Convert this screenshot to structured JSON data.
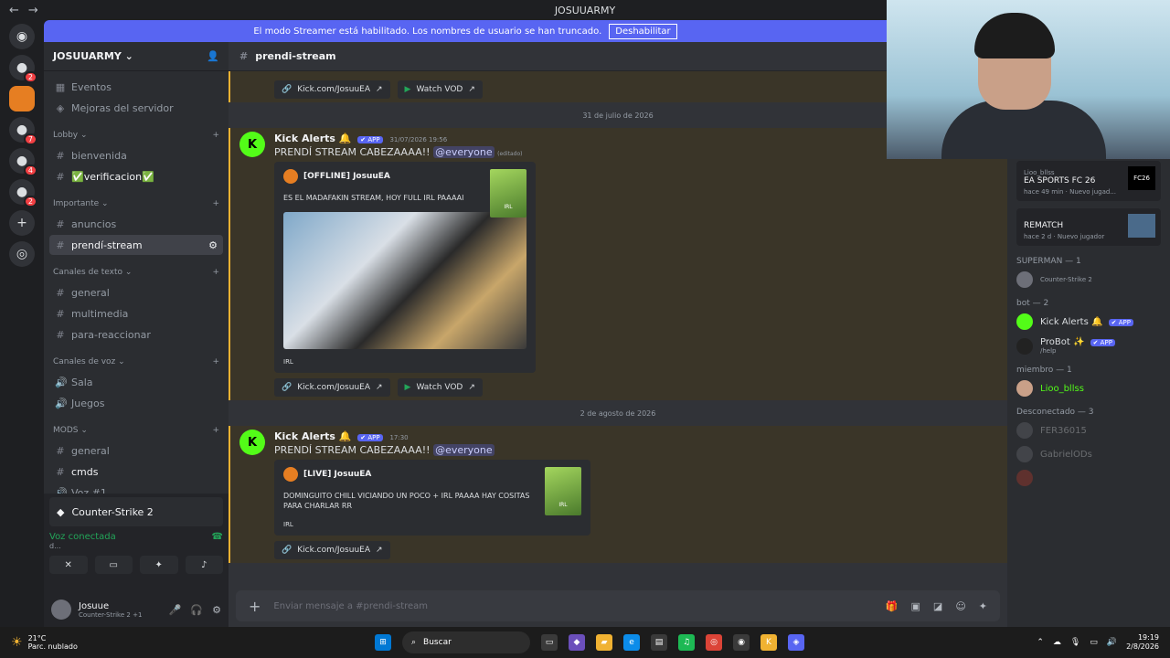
{
  "window": {
    "title": "JOSUUARMY",
    "back": "←",
    "forward": "→"
  },
  "banner": {
    "text": "El modo Streamer está habilitado. Los nombres de usuario se han truncado.",
    "button": "Deshabilitar"
  },
  "servers": [
    {
      "name": "discord-home",
      "glyph": "◉",
      "badge": ""
    },
    {
      "name": "server-1",
      "glyph": "●",
      "badge": "2"
    },
    {
      "name": "server-josuuarmy",
      "glyph": "●",
      "badge": ""
    },
    {
      "name": "server-3",
      "glyph": "●",
      "badge": "7"
    },
    {
      "name": "server-4",
      "glyph": "●",
      "badge": "4"
    },
    {
      "name": "server-5",
      "glyph": "●",
      "badge": "2"
    },
    {
      "name": "add-server",
      "glyph": "+",
      "badge": ""
    },
    {
      "name": "discover",
      "glyph": "◎",
      "badge": ""
    }
  ],
  "guild": {
    "name": "JOSUUARMY ⌄"
  },
  "channels": {
    "top": [
      {
        "icon": "▦",
        "label": "Eventos"
      },
      {
        "icon": "◈",
        "label": "Mejoras del servidor"
      }
    ],
    "cat_lobby": "Lobby ⌄",
    "lobby": [
      {
        "icon": "#",
        "label": "bienvenida"
      },
      {
        "icon": "#",
        "label": "✅verificacion✅"
      }
    ],
    "cat_importante": "Importante ⌄",
    "importante": [
      {
        "icon": "#",
        "label": "anuncios"
      },
      {
        "icon": "#",
        "label": "prendí-stream"
      }
    ],
    "cat_texto": "Canales de texto ⌄",
    "texto": [
      {
        "icon": "#",
        "label": "general"
      },
      {
        "icon": "#",
        "label": "multimedia"
      },
      {
        "icon": "#",
        "label": "para-reaccionar"
      }
    ],
    "cat_voz": "Canales de voz ⌄",
    "voz": [
      {
        "icon": "🔊",
        "label": "Sala"
      },
      {
        "icon": "🔊",
        "label": "Juegos"
      }
    ],
    "cat_mods": "MODS ⌄",
    "mods": [
      {
        "icon": "#",
        "label": "general"
      },
      {
        "icon": "#",
        "label": "cmds"
      },
      {
        "icon": "🔊",
        "label": "Voz #1"
      }
    ]
  },
  "panel": {
    "game": "Counter-Strike 2",
    "voice": "Voz conectada",
    "voice_sub": "d...",
    "user_name": "Josuue",
    "user_status": "Counter-Strike 2 +1"
  },
  "chat": {
    "channel": "prendi-stream",
    "top_links": {
      "kick": "Kick.com/JosuuEA",
      "vod": "Watch VOD"
    },
    "date1": "31 de julio de 2026",
    "msg1": {
      "author": "Kick Alerts 🔔",
      "badge": "✔ APP",
      "time": "31/07/2026 19:56",
      "text": "PRENDÍ STREAM CABEZAAAA!!",
      "mention": "@everyone",
      "edited": "(editado)",
      "embed_author": "[OFFLINE] JosuuEA",
      "embed_desc": "ES EL MADAFAKIN STREAM, HOY FULL IRL PAAAAI",
      "thumb": "IRL",
      "category": "IRL",
      "kick": "Kick.com/JosuuEA",
      "vod": "Watch VOD"
    },
    "date2": "2 de agosto de 2026",
    "msg2": {
      "author": "Kick Alerts 🔔",
      "badge": "✔ APP",
      "time": "17:30",
      "text": "PRENDÍ STREAM CABEZAAAA!!",
      "mention": "@everyone",
      "embed_author": "[LIVE] JosuuEA",
      "embed_desc": "DOMINGUITO CHILL VICIANDO UN POCO + IRL PAAAA HAY COSITAS PARA CHARLAR RR",
      "thumb": "IRL",
      "category": "IRL",
      "kick": "Kick.com/JosuuEA"
    },
    "composer_placeholder": "Enviar mensaje a #prendi-stream"
  },
  "members": {
    "activity1": {
      "name": "Lioo_bllss",
      "title": "EA SPORTS FC 26",
      "sub": "hace 49 min · Nuevo jugad...",
      "img": "FC26"
    },
    "activity2": {
      "title": "REMATCH",
      "sub": "hace 2 d · Nuevo jugador"
    },
    "group_superman": "SUPERMAN — 1",
    "superman": [
      {
        "name": "",
        "status": "Counter-Strike 2"
      }
    ],
    "group_bot": "bot — 2",
    "bots": [
      {
        "name": "Kick Alerts 🔔",
        "badge": "✔ APP",
        "status": ""
      },
      {
        "name": "ProBot ✨",
        "badge": "✔ APP",
        "status": "/help"
      }
    ],
    "group_miembro": "miembro — 1",
    "miembros": [
      {
        "name": "Lioo_bllss",
        "status": ""
      }
    ],
    "group_offline": "Desconectado — 3",
    "offline": [
      {
        "name": "FER36015"
      },
      {
        "name": "GabrielODs"
      },
      {
        "name": ""
      }
    ]
  },
  "taskbar": {
    "temp": "21°C",
    "weather": "Parc. nublado",
    "search": "Buscar",
    "time": "19:19",
    "date": "2/8/2026"
  },
  "colors": {
    "accent": "#5865f2",
    "kick_green": "#53fc18",
    "highlight": "#f0b232"
  }
}
